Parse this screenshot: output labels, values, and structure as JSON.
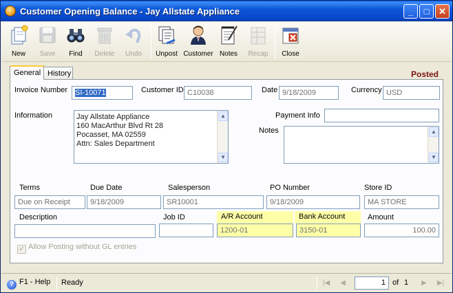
{
  "window": {
    "title": "Customer Opening Balance - Jay Allstate Appliance"
  },
  "toolbar": {
    "buttons": [
      {
        "label": "New",
        "icon": "new-document-icon",
        "enabled": true
      },
      {
        "label": "Save",
        "icon": "floppy-disk-icon",
        "enabled": false
      },
      {
        "label": "Find",
        "icon": "binoculars-icon",
        "enabled": true
      },
      {
        "label": "Delete",
        "icon": "trash-icon",
        "enabled": false
      },
      {
        "label": "Undo",
        "icon": "undo-arrow-icon",
        "enabled": false
      },
      {
        "label": "Unpost",
        "icon": "unpost-icon",
        "enabled": true
      },
      {
        "label": "Customer",
        "icon": "person-icon",
        "enabled": true
      },
      {
        "label": "Notes",
        "icon": "notepad-icon",
        "enabled": true
      },
      {
        "label": "Recap",
        "icon": "recap-icon",
        "enabled": false
      },
      {
        "label": "Close",
        "icon": "close-icon",
        "enabled": true
      }
    ]
  },
  "tabs": [
    {
      "label": "General",
      "active": true
    },
    {
      "label": "History",
      "active": false
    }
  ],
  "status": "Posted",
  "form": {
    "invoice_number_label": "Invoice Number",
    "invoice_number": "SI-10071",
    "customer_id_label": "Customer ID",
    "customer_id": "C10038",
    "date_label": "Date",
    "date": "9/18/2009",
    "currency_label": "Currency",
    "currency": "USD",
    "information_label": "Information",
    "information_lines": [
      "Jay Allstate Appliance",
      "160 MacArthur Blvd Rt 28",
      "Pocasset, MA 02559",
      "Attn: Sales Department"
    ],
    "payment_info_label": "Payment Info",
    "payment_info": "",
    "notes_label": "Notes",
    "notes": "",
    "terms_label": "Terms",
    "terms": "Due on Receipt",
    "due_date_label": "Due Date",
    "due_date": "9/18/2009",
    "salesperson_label": "Salesperson",
    "salesperson": "SR10001",
    "po_number_label": "PO Number",
    "po_number": "9/18/2009",
    "store_id_label": "Store ID",
    "store_id": "MA STORE",
    "description_label": "Description",
    "description": "",
    "job_id_label": "Job ID",
    "job_id": "",
    "ar_account_label": "A/R Account",
    "ar_account": "1200-01",
    "bank_account_label": "Bank Account",
    "bank_account": "3150-01",
    "amount_label": "Amount",
    "amount": "100.00",
    "allow_posting_label": "Allow Posting without GL entries",
    "allow_posting_checked": true
  },
  "statusbar": {
    "help": "F1 - Help",
    "state": "Ready",
    "page": "1",
    "of_label": "of",
    "total_pages": "1"
  }
}
